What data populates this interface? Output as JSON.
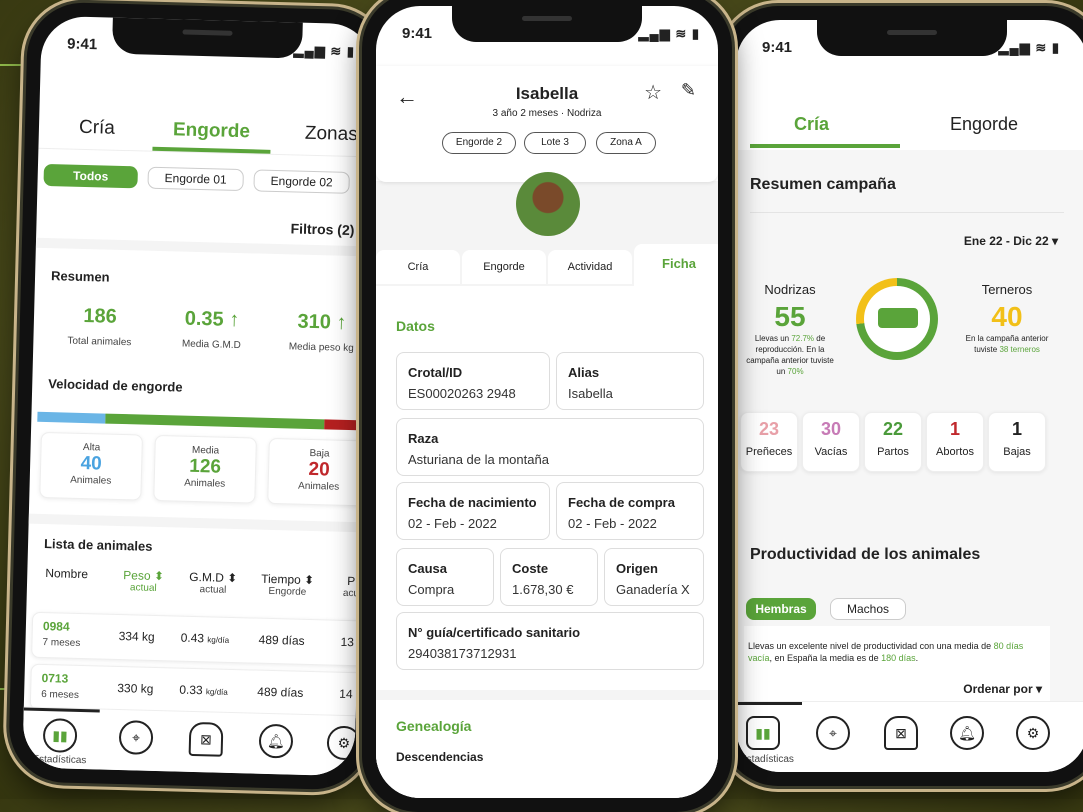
{
  "status": {
    "time": "9:41"
  },
  "left": {
    "tabs": [
      "Cría",
      "Engorde",
      "Zonas"
    ],
    "filters": [
      "Todos",
      "Engorde 01",
      "Engorde 02"
    ],
    "filtros": "Filtros (2)",
    "resumen_title": "Resumen",
    "stats": [
      {
        "value": "186",
        "label": "Total animales"
      },
      {
        "value": "0.35 ↑",
        "label": "Media G.M.D"
      },
      {
        "value": "310 ↑",
        "label": "Media peso kg"
      }
    ],
    "velocidad_title": "Velocidad de engorde",
    "speed": [
      {
        "label": "Alta",
        "value": "40",
        "unit": "Animales"
      },
      {
        "label": "Media",
        "value": "126",
        "unit": "Animales"
      },
      {
        "label": "Baja",
        "value": "20",
        "unit": "Animales"
      }
    ],
    "speed_shares": [
      0.21,
      0.67,
      0.12
    ],
    "lista_title": "Lista de animales",
    "columns": [
      {
        "name": "Nombre",
        "sub": ""
      },
      {
        "name": "Peso ⬍",
        "sub": "actual"
      },
      {
        "name": "G.M.D ⬍",
        "sub": "actual"
      },
      {
        "name": "Tiempo ⬍",
        "sub": "Engorde"
      },
      {
        "name": "P",
        "sub": "acu"
      }
    ],
    "rows": [
      {
        "id": "0984",
        "age": "7 meses",
        "peso": "334 kg",
        "gmd": "0.43",
        "gmd_unit": "kg/día",
        "tiempo": "489 días",
        "p": "13"
      },
      {
        "id": "0713",
        "age": "6 meses",
        "peso": "330 kg",
        "gmd": "0.33",
        "gmd_unit": "kg/día",
        "tiempo": "489 días",
        "p": "14"
      }
    ],
    "nav_label": "Estadísticas"
  },
  "middle": {
    "name": "Isabella",
    "subtitle": "3 año 2 meses · Nodriza",
    "tags": [
      "Engorde 2",
      "Lote 3",
      "Zona A"
    ],
    "tabs": [
      "Cría",
      "Engorde",
      "Actividad",
      "Ficha"
    ],
    "datos_title": "Datos",
    "fields": {
      "crotal": {
        "label": "Crotal/ID",
        "value": "ES00020263 2948"
      },
      "alias": {
        "label": "Alias",
        "value": "Isabella"
      },
      "raza": {
        "label": "Raza",
        "value": "Asturiana de la montaña"
      },
      "nacimiento": {
        "label": "Fecha de nacimiento",
        "value": "02 - Feb - 2022"
      },
      "compra": {
        "label": "Fecha de compra",
        "value": "02 - Feb - 2022"
      },
      "causa": {
        "label": "Causa",
        "value": "Compra"
      },
      "coste": {
        "label": "Coste",
        "value": "1.678,30 €"
      },
      "origen": {
        "label": "Origen",
        "value": "Ganadería X"
      },
      "guia": {
        "label": "N° guía/certificado sanitario",
        "value": "294038173712931"
      }
    },
    "genealogia_title": "Genealogía",
    "descendencias_title": "Descendencias"
  },
  "right": {
    "tabs": [
      "Cría",
      "Engorde"
    ],
    "resumen_title": "Resumen campaña",
    "range": "Ene 22 - Dic 22",
    "nodrizas": {
      "label": "Nodrizas",
      "value": "55",
      "note_pre": "Llevas un ",
      "note_pct": "72.7%",
      "note_mid": " de reproducción. En la campaña anterior tuviste un ",
      "note_pct2": "70%"
    },
    "terneros": {
      "label": "Terneros",
      "value": "40",
      "note_pre": "En la campaña anterior tuviste ",
      "note_hl": "38 terneros"
    },
    "stats": [
      {
        "value": "23",
        "label": "Preñeces",
        "color": "#e8a0a8"
      },
      {
        "value": "30",
        "label": "Vacías",
        "color": "#c77bb6"
      },
      {
        "value": "22",
        "label": "Partos",
        "color": "#4a9a3a"
      },
      {
        "value": "1",
        "label": "Abortos",
        "color": "#c0282c"
      },
      {
        "value": "1",
        "label": "Bajas",
        "color": "#222222"
      }
    ],
    "productividad_title": "Productividad de los animales",
    "toggle": [
      "Hembras",
      "Machos"
    ],
    "prod_pre": "Llevas un excelente nivel de productividad con una media de ",
    "prod_hl1": "80 días vacía",
    "prod_mid": ", en España la media es de ",
    "prod_hl2": "180 días",
    "prod_end": ".",
    "ordenar": "Ordenar por",
    "nav_label": "Estadísticas"
  }
}
